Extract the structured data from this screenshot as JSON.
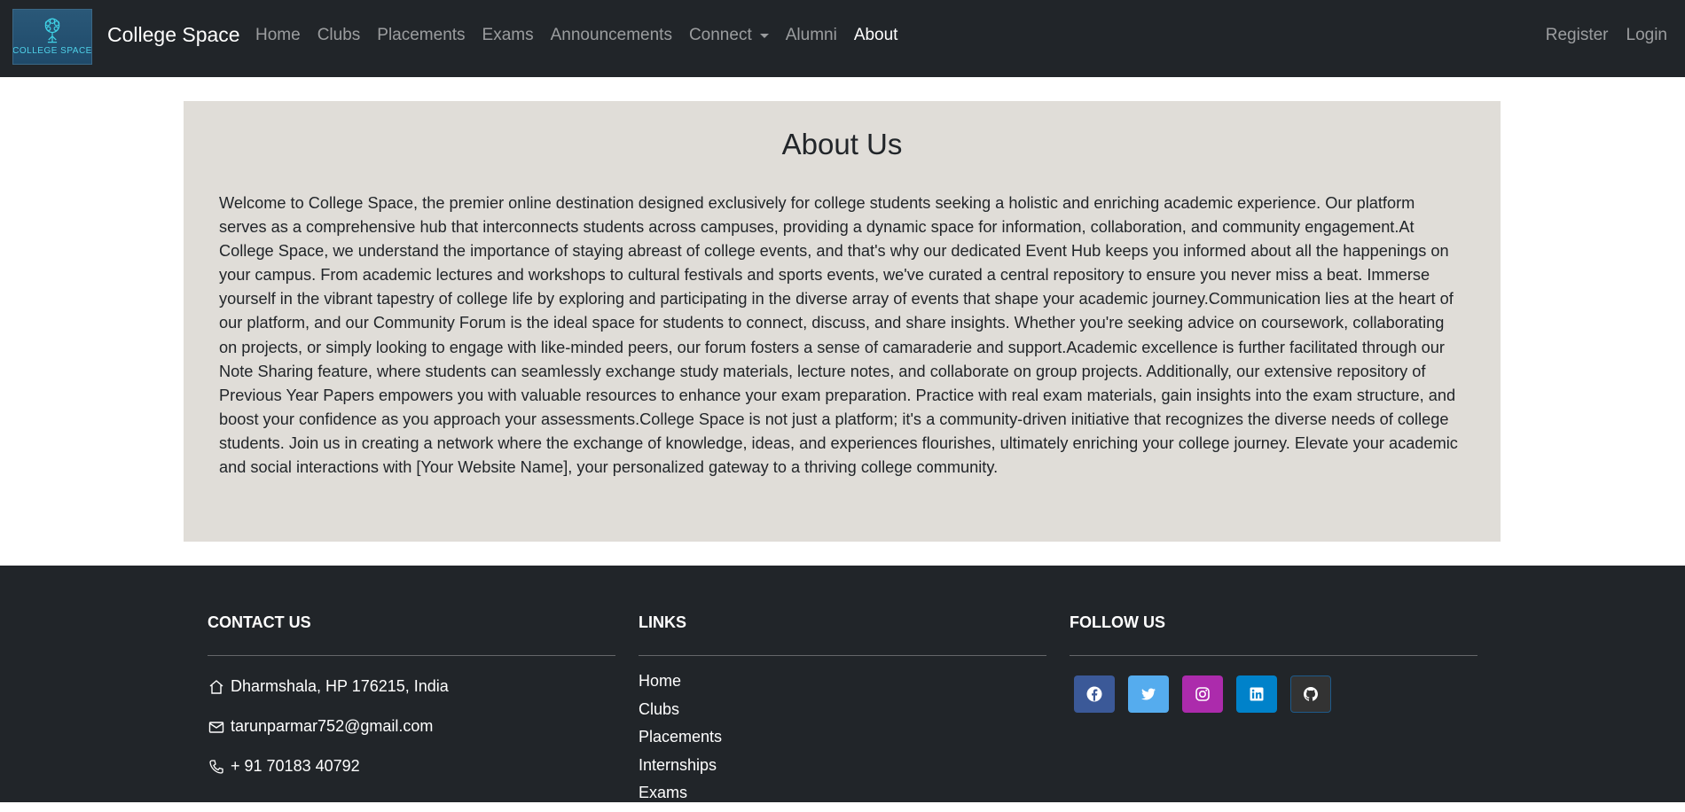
{
  "navbar": {
    "logo_text": "COLLEGE SPACE",
    "brand": "College Space",
    "links": [
      {
        "label": "Home"
      },
      {
        "label": "Clubs"
      },
      {
        "label": "Placements"
      },
      {
        "label": "Exams"
      },
      {
        "label": "Announcements"
      },
      {
        "label": "Connect"
      },
      {
        "label": "Alumni"
      },
      {
        "label": "About",
        "active": true
      }
    ],
    "right_links": [
      {
        "label": "Register"
      },
      {
        "label": "Login"
      }
    ]
  },
  "about": {
    "title": "About Us",
    "body": "Welcome to College Space, the premier online destination designed exclusively for college students seeking a holistic and enriching academic experience. Our platform serves as a comprehensive hub that interconnects students across campuses, providing a dynamic space for information, collaboration, and community engagement.At College Space, we understand the importance of staying abreast of college events, and that's why our dedicated Event Hub keeps you informed about all the happenings on your campus. From academic lectures and workshops to cultural festivals and sports events, we've curated a central repository to ensure you never miss a beat. Immerse yourself in the vibrant tapestry of college life by exploring and participating in the diverse array of events that shape your academic journey.Communication lies at the heart of our platform, and our Community Forum is the ideal space for students to connect, discuss, and share insights. Whether you're seeking advice on coursework, collaborating on projects, or simply looking to engage with like-minded peers, our forum fosters a sense of camaraderie and support.Academic excellence is further facilitated through our Note Sharing feature, where students can seamlessly exchange study materials, lecture notes, and collaborate on group projects. Additionally, our extensive repository of Previous Year Papers empowers you with valuable resources to enhance your exam preparation. Practice with real exam materials, gain insights into the exam structure, and boost your confidence as you approach your assessments.College Space is not just a platform; it's a community-driven initiative that recognizes the diverse needs of college students. Join us in creating a network where the exchange of knowledge, ideas, and experiences flourishes, ultimately enriching your college journey. Elevate your academic and social interactions with [Your Website Name], your personalized gateway to a thriving college community."
  },
  "footer": {
    "contact": {
      "heading": "CONTACT US",
      "address": "Dharmshala, HP 176215, India",
      "email": "tarunparmar752@gmail.com",
      "phone": "+ 91 70183 40792"
    },
    "links": {
      "heading": "LINKS",
      "items": [
        "Home",
        "Clubs",
        "Placements",
        "Internships",
        "Exams"
      ]
    },
    "follow": {
      "heading": "FOLLOW US",
      "icons": [
        {
          "name": "facebook-icon",
          "color": "#3b5998"
        },
        {
          "name": "twitter-icon",
          "color": "#55acee"
        },
        {
          "name": "instagram-icon",
          "color": "#ac2bac"
        },
        {
          "name": "linkedin-icon",
          "color": "#0082ca"
        },
        {
          "name": "github-icon",
          "color": "#333333"
        }
      ]
    }
  },
  "colors": {
    "navbar_bg": "#212529",
    "about_bg": "#e0ddd8",
    "footer_bg": "#212529"
  }
}
